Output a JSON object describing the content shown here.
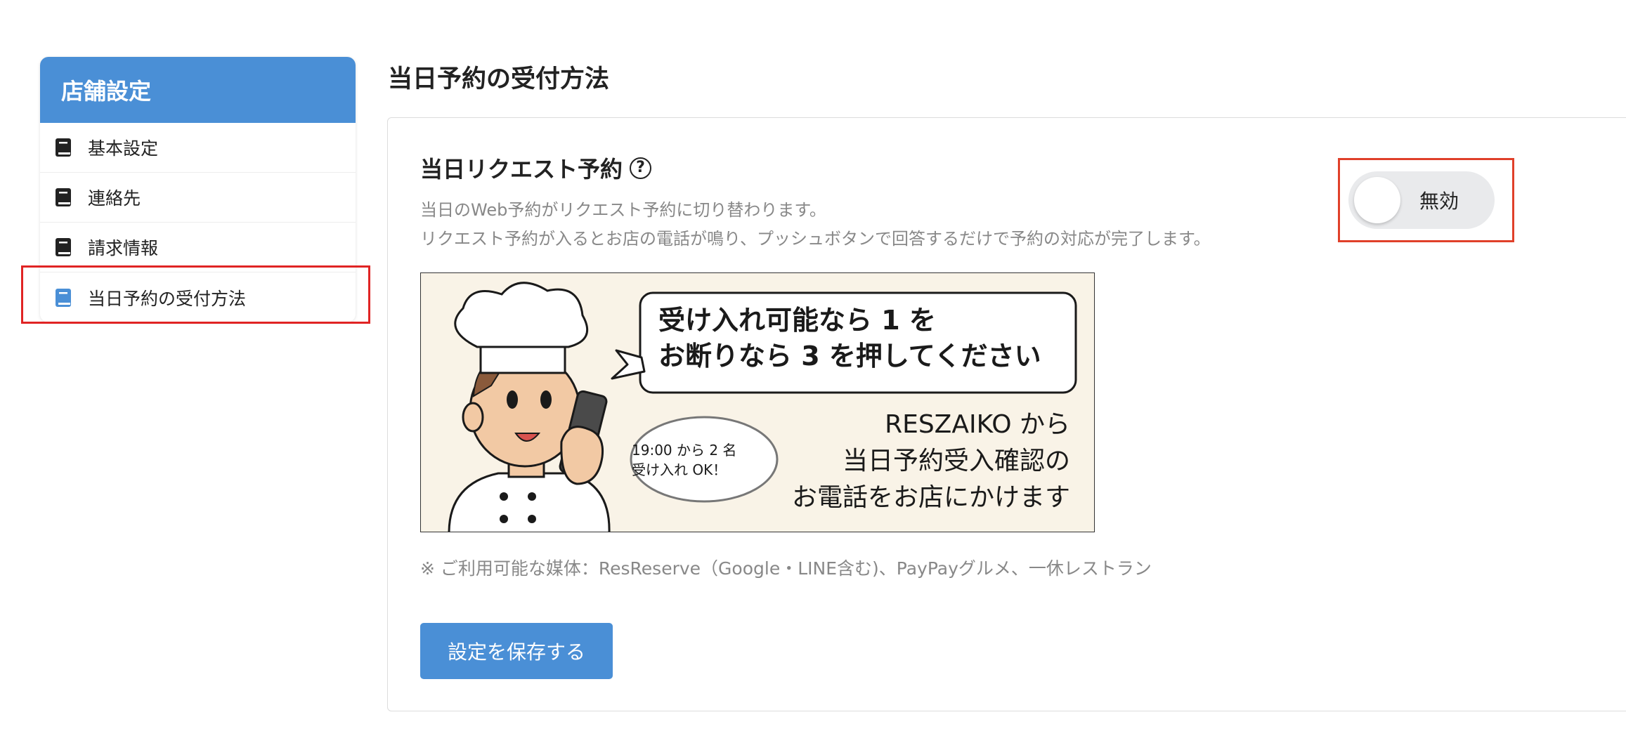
{
  "sidebar": {
    "title": "店舗設定",
    "items": [
      {
        "label": "基本設定",
        "icon": "book-icon"
      },
      {
        "label": "連絡先",
        "icon": "book-icon"
      },
      {
        "label": "請求情報",
        "icon": "book-icon"
      },
      {
        "label": "当日予約の受付方法",
        "icon": "book-icon",
        "active": true
      }
    ],
    "icon_color": "#222222",
    "active_icon_color": "#4a8fd6"
  },
  "main": {
    "title": "当日予約の受付方法",
    "section": {
      "title": "当日リクエスト予約",
      "help_icon_glyph": "?",
      "description_line1": "当日のWeb予約がリクエスト予約に切り替わります。",
      "description_line2": "リクエスト予約が入るとお店の電話が鳴り、プッシュボタンで回答するだけで予約の対応が完了します。",
      "toggle": {
        "label": "無効",
        "enabled": false
      }
    },
    "banner": {
      "bubble_line1": "受け入れ可能なら 1 を",
      "bubble_line2": "お断りなら 3 を押してください",
      "small_bubble_line1": "19:00 から 2 名",
      "small_bubble_line2": "受け入れ OK！",
      "right_line1": "RESZAIKO から",
      "right_line2": "当日予約受入確認の",
      "right_line3": "お電話をお店にかけます"
    },
    "note": "※ ご利用可能な媒体：ResReserve（Google・LINE含む)、PayPayグルメ、一休レストラン",
    "save_label": "設定を保存する"
  },
  "colors": {
    "accent": "#4a8fd6",
    "highlight_red": "#e02424",
    "toggle_bg": "#e9eaec"
  }
}
